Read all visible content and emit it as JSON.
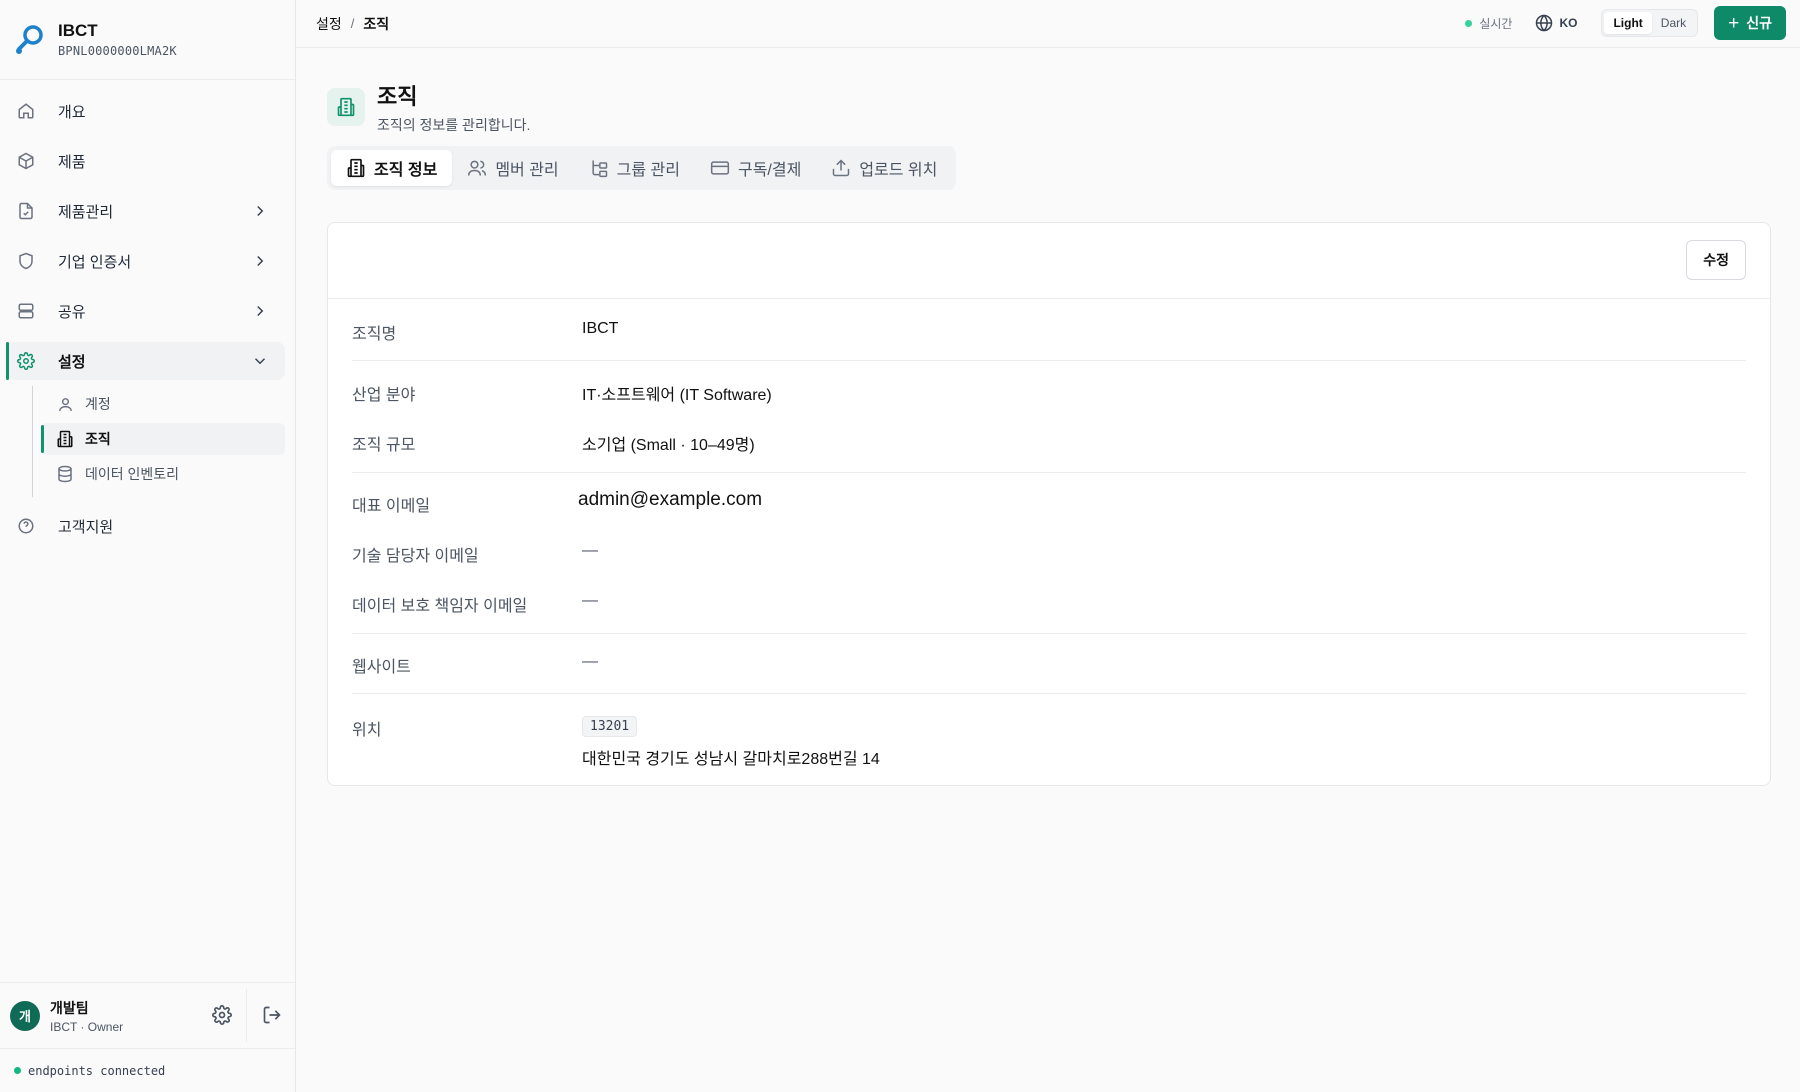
{
  "brand": {
    "name": "IBCT",
    "id": "BPNL0000000LMA2K"
  },
  "sidebar": {
    "items": [
      {
        "label": "개요",
        "icon": "home-icon"
      },
      {
        "label": "제품",
        "icon": "package-icon"
      },
      {
        "label": "제품관리",
        "icon": "file-check-icon"
      },
      {
        "label": "기업 인증서",
        "icon": "shield-icon"
      },
      {
        "label": "공유",
        "icon": "server-icon"
      },
      {
        "label": "설정",
        "icon": "gear-icon"
      },
      {
        "label": "고객지원",
        "icon": "help-circle-icon"
      }
    ],
    "subitems": [
      {
        "label": "계정",
        "icon": "user-icon"
      },
      {
        "label": "조직",
        "icon": "building-icon"
      },
      {
        "label": "데이터 인벤토리",
        "icon": "database-icon"
      }
    ]
  },
  "user": {
    "avatar": "개",
    "name": "개발팀",
    "role": "IBCT · Owner"
  },
  "status": {
    "text": "endpoints connected"
  },
  "header": {
    "breadcrumb": [
      "설정",
      "조직"
    ],
    "live": "실시간",
    "lang": "KO",
    "theme_light": "Light",
    "theme_dark": "Dark",
    "new_button": "신규"
  },
  "page": {
    "title": "조직",
    "subtitle": "조직의 정보를 관리합니다."
  },
  "tabs": [
    {
      "label": "조직 정보",
      "icon": "building-icon"
    },
    {
      "label": "멤버 관리",
      "icon": "users-icon"
    },
    {
      "label": "그룹 관리",
      "icon": "tree-icon"
    },
    {
      "label": "구독/결제",
      "icon": "credit-card-icon"
    },
    {
      "label": "업로드 위치",
      "icon": "upload-icon"
    }
  ],
  "card": {
    "edit_button": "수정",
    "fields": [
      {
        "label": "조직명",
        "value": "IBCT"
      },
      {
        "label": "산업 분야",
        "value": "IT·소프트웨어 (IT Software)"
      },
      {
        "label": "조직 규모",
        "value": "소기업 (Small · 10–49명)"
      },
      {
        "label": "대표 이메일",
        "value": "admin@example.com"
      },
      {
        "label": "기술 담당자 이메일",
        "value": "—"
      },
      {
        "label": "데이터 보호 책임자 이메일",
        "value": "—"
      },
      {
        "label": "웹사이트",
        "value": "—"
      },
      {
        "label": "위치",
        "zip": "13201",
        "value": "대한민국 경기도 성남시 갈마치로288번길 14"
      }
    ]
  },
  "colors": {
    "accent": "#10926b",
    "primary_button": "#0f8a69"
  }
}
